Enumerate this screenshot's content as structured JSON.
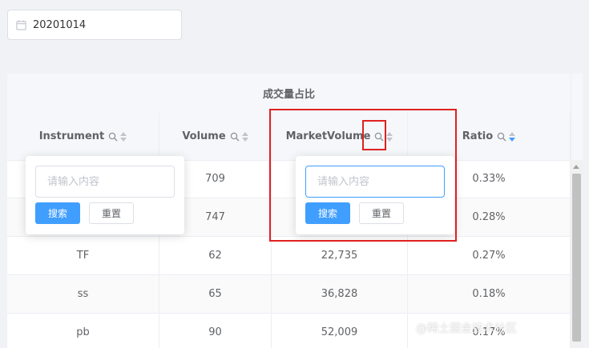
{
  "date_picker": {
    "value": "20201014",
    "icon": "calendar-icon"
  },
  "table": {
    "group_header": "成交量占比",
    "columns": [
      {
        "label": "Instrument",
        "active_sort": false
      },
      {
        "label": "Volume",
        "active_sort": false
      },
      {
        "label": "MarketVolume",
        "active_sort": false
      },
      {
        "label": "Ratio",
        "active_sort": true
      }
    ],
    "rows": [
      [
        "",
        "709",
        "",
        "0.33%"
      ],
      [
        "",
        "747",
        "",
        "0.28%"
      ],
      [
        "TF",
        "62",
        "22,735",
        "0.27%"
      ],
      [
        "ss",
        "65",
        "36,828",
        "0.18%"
      ],
      [
        "pb",
        "90",
        "52,009",
        "0.17%"
      ]
    ]
  },
  "filter_popover_instrument": {
    "placeholder": "请输入内容",
    "search_label": "搜索",
    "reset_label": "重置"
  },
  "filter_popover_marketvolume": {
    "placeholder": "请输入内容",
    "search_label": "搜索",
    "reset_label": "重置"
  },
  "watermark": "@稀土掘金技术社区",
  "colors": {
    "primary": "#409eff",
    "highlight": "#e02020"
  }
}
